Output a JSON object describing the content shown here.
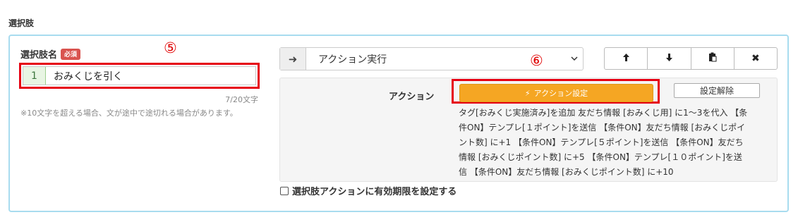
{
  "section_title": "選択肢",
  "choice": {
    "label": "選択肢名",
    "required_badge": "必須",
    "number": "1",
    "value": "おみくじを引く",
    "char_count": "7/20文字",
    "hint": "※10文字を超える場合、文が途中で途切れる場合があります。"
  },
  "annotations": {
    "five": "⑤",
    "six": "⑥"
  },
  "action_select": {
    "icon": "arrow-right-icon",
    "value": "アクション実行"
  },
  "button_group": {
    "up_icon": "arrow-up-icon",
    "down_icon": "arrow-down-icon",
    "copy_icon": "clipboard-icon",
    "close_icon": "close-icon"
  },
  "action": {
    "label": "アクション",
    "set_button": "アクション設定",
    "clear_button": "設定解除",
    "description": "タグ[おみくじ実施済み]を追加 友だち情報 [おみくじ用] に1〜3を代入 【条件ON】テンプレ[１ポイント]を送信 【条件ON】友だち情報 [おみくじポイント数] に+1 【条件ON】テンプレ[５ポイント]を送信 【条件ON】友だち情報 [おみくじポイント数] に+5 【条件ON】テンプレ[１０ポイント]を送信 【条件ON】友だち情報 [おみくじポイント数] に+10"
  },
  "expiry_label": "選択肢アクションに有効期限を設定する",
  "colors": {
    "panel_border": "#a8dcef",
    "highlight_red": "#e60012",
    "action_orange": "#f5a623",
    "badge_red": "#d9534f"
  }
}
